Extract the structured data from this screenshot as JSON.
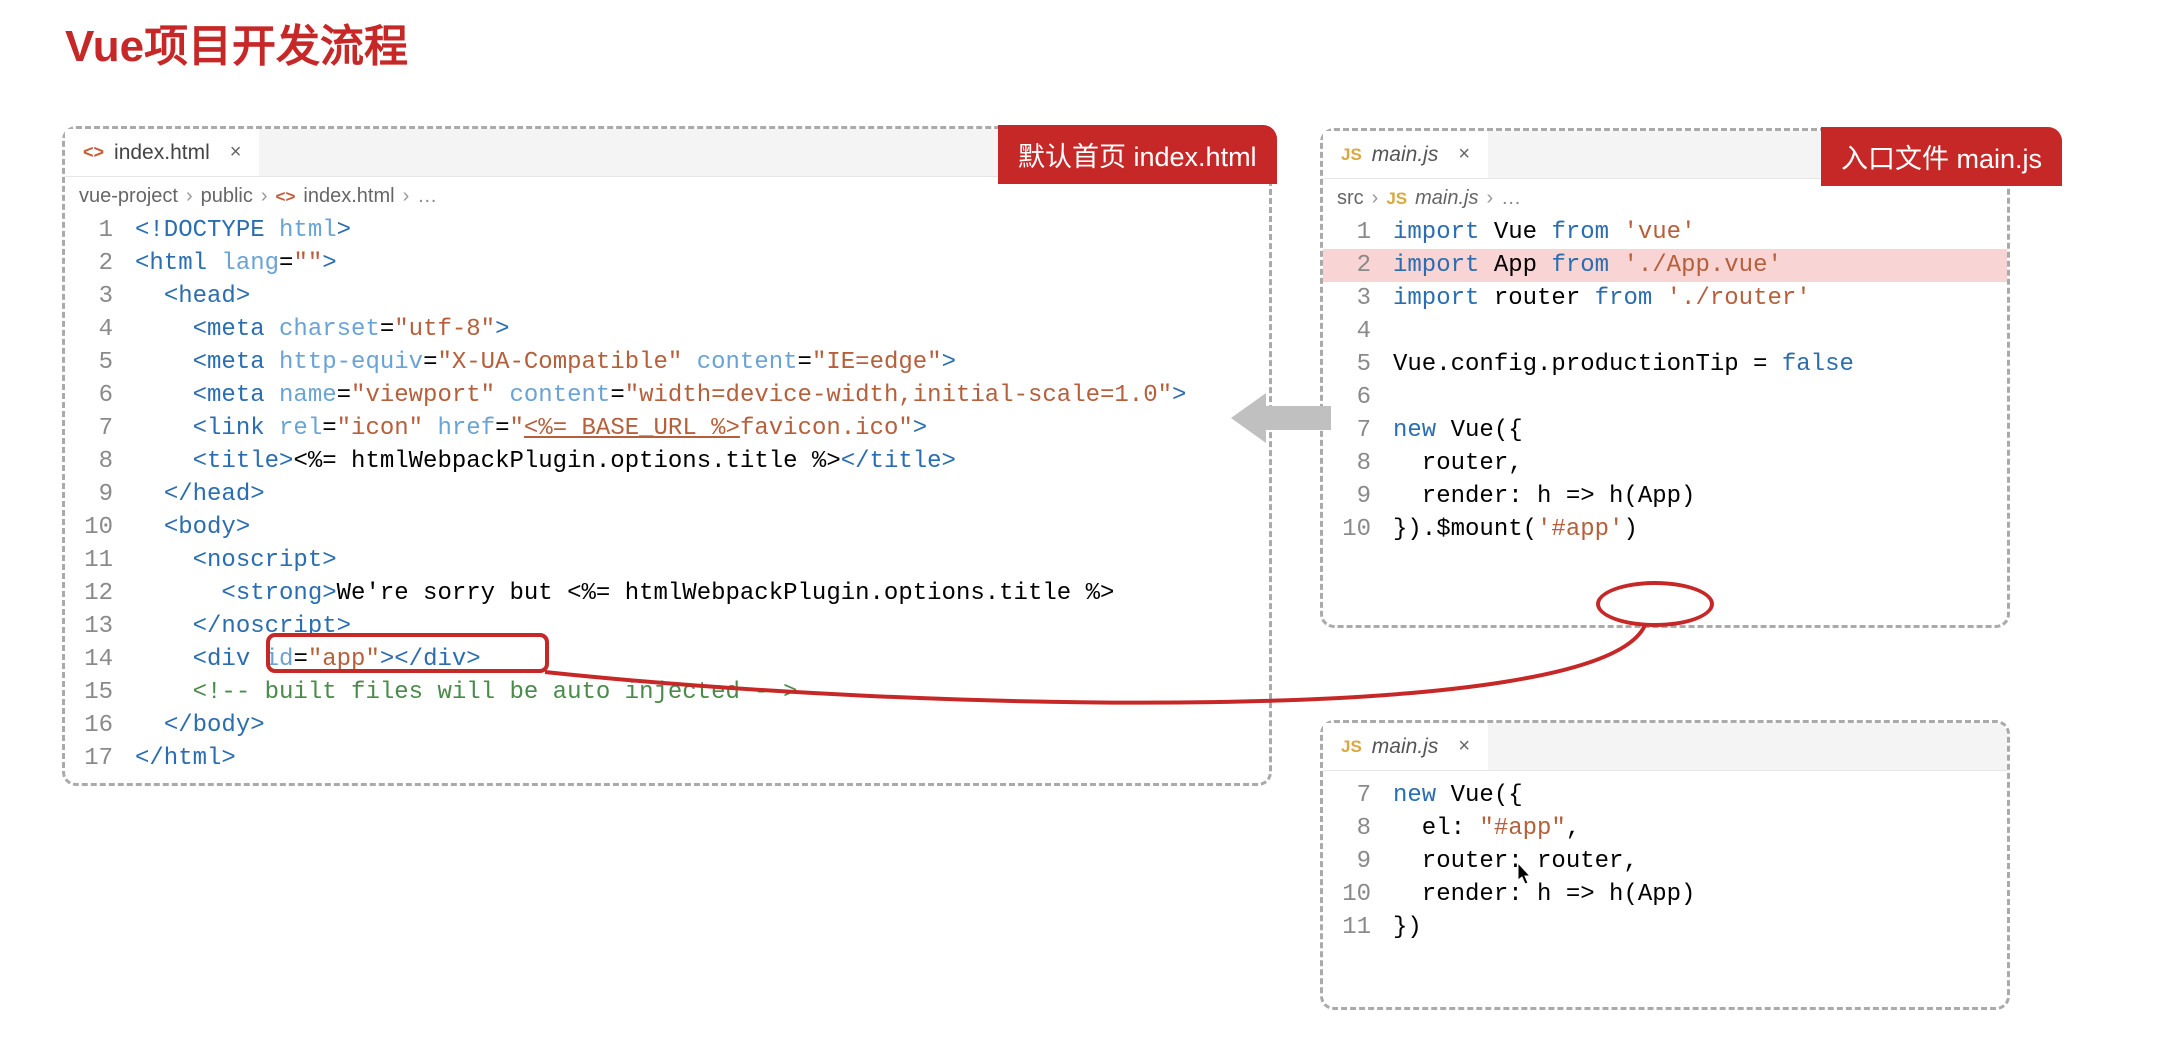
{
  "title": "Vue项目开发流程",
  "badges": {
    "left": "默认首页 index.html",
    "right": "入口文件 main.js"
  },
  "left_panel": {
    "tab": {
      "filename": "index.html"
    },
    "breadcrumb": [
      "vue-project",
      "public",
      "index.html",
      "…"
    ],
    "code": [
      {
        "n": 1,
        "html": "<span class='tag'>&lt;!DOCTYPE</span> <span class='attr'>html</span><span class='tag'>&gt;</span>"
      },
      {
        "n": 2,
        "html": "<span class='tag'>&lt;html</span> <span class='attr'>lang</span>=<span class='str'>\"\"</span><span class='tag'>&gt;</span>"
      },
      {
        "n": 3,
        "html": "  <span class='tag'>&lt;head&gt;</span>"
      },
      {
        "n": 4,
        "html": "    <span class='tag'>&lt;meta</span> <span class='attr'>charset</span>=<span class='str'>\"utf-8\"</span><span class='tag'>&gt;</span>"
      },
      {
        "n": 5,
        "html": "    <span class='tag'>&lt;meta</span> <span class='attr'>http-equiv</span>=<span class='str'>\"X-UA-Compatible\"</span> <span class='attr'>content</span>=<span class='str'>\"IE=edge\"</span><span class='tag'>&gt;</span>"
      },
      {
        "n": 6,
        "html": "    <span class='tag'>&lt;meta</span> <span class='attr'>name</span>=<span class='str'>\"viewport\"</span> <span class='attr'>content</span>=<span class='str'>\"width=device-width,initial-scale=1.0\"</span><span class='tag'>&gt;</span>"
      },
      {
        "n": 7,
        "html": "    <span class='tag'>&lt;link</span> <span class='attr'>rel</span>=<span class='str'>\"icon\"</span> <span class='attr'>href</span>=<span class='str'>\"<u>&lt;%= BASE_URL %&gt;</u>favicon.ico\"</span><span class='tag'>&gt;</span>"
      },
      {
        "n": 8,
        "html": "    <span class='tag'>&lt;title&gt;</span>&lt;%= htmlWebpackPlugin.options.title %&gt;<span class='tag'>&lt;/title&gt;</span>"
      },
      {
        "n": 9,
        "html": "  <span class='tag'>&lt;/head&gt;</span>"
      },
      {
        "n": 10,
        "html": "  <span class='tag'>&lt;body&gt;</span>"
      },
      {
        "n": 11,
        "html": "    <span class='tag'>&lt;noscript&gt;</span>"
      },
      {
        "n": 12,
        "html": "      <span class='tag'>&lt;strong&gt;</span>We're sorry but &lt;%= htmlWebpackPlugin.options.title %&gt;"
      },
      {
        "n": 13,
        "html": "    <span class='tag'>&lt;/noscript&gt;</span>"
      },
      {
        "n": 14,
        "html": "    <span class='tag'>&lt;div</span> <span class='attr'>id</span>=<span class='str'>\"app\"</span><span class='tag'>&gt;&lt;/div&gt;</span>"
      },
      {
        "n": 15,
        "html": "    <span class='comment'>&lt;!-- built files will be auto injected --&gt;</span>"
      },
      {
        "n": 16,
        "html": "  <span class='tag'>&lt;/body&gt;</span>"
      },
      {
        "n": 17,
        "html": "<span class='tag'>&lt;/html&gt;</span>"
      }
    ]
  },
  "right_top_panel": {
    "tab": {
      "filename": "main.js"
    },
    "breadcrumb": [
      "src",
      "main.js",
      "…"
    ],
    "code": [
      {
        "n": 1,
        "html": "<span class='kw'>import</span> Vue <span class='kw'>from</span> <span class='str'>'vue'</span>"
      },
      {
        "n": 2,
        "hl": true,
        "html": "<span class='kw'>import</span> App <span class='kw'>from</span> <span class='str'>'./App.vue'</span>"
      },
      {
        "n": 3,
        "html": "<span class='kw'>import</span> router <span class='kw'>from</span> <span class='str'>'./router'</span>"
      },
      {
        "n": 4,
        "html": ""
      },
      {
        "n": 5,
        "html": "Vue.config.productionTip = <span class='lit'>false</span>"
      },
      {
        "n": 6,
        "html": ""
      },
      {
        "n": 7,
        "html": "<span class='kw'>new</span> Vue({"
      },
      {
        "n": 8,
        "html": "  router,"
      },
      {
        "n": 9,
        "html": "  render: h =&gt; h(App)"
      },
      {
        "n": 10,
        "html": "}).$mount(<span class='str'>'#app'</span>)"
      }
    ]
  },
  "right_bottom_panel": {
    "tab": {
      "filename": "main.js"
    },
    "code": [
      {
        "n": 7,
        "html": "<span class='kw'>new</span> Vue({"
      },
      {
        "n": 8,
        "html": "  el: <span class='str'>\"#app\"</span>,"
      },
      {
        "n": 9,
        "html": "  router: router,"
      },
      {
        "n": 10,
        "html": "  render: h =&gt; h(App)"
      },
      {
        "n": 11,
        "html": "})"
      }
    ]
  }
}
